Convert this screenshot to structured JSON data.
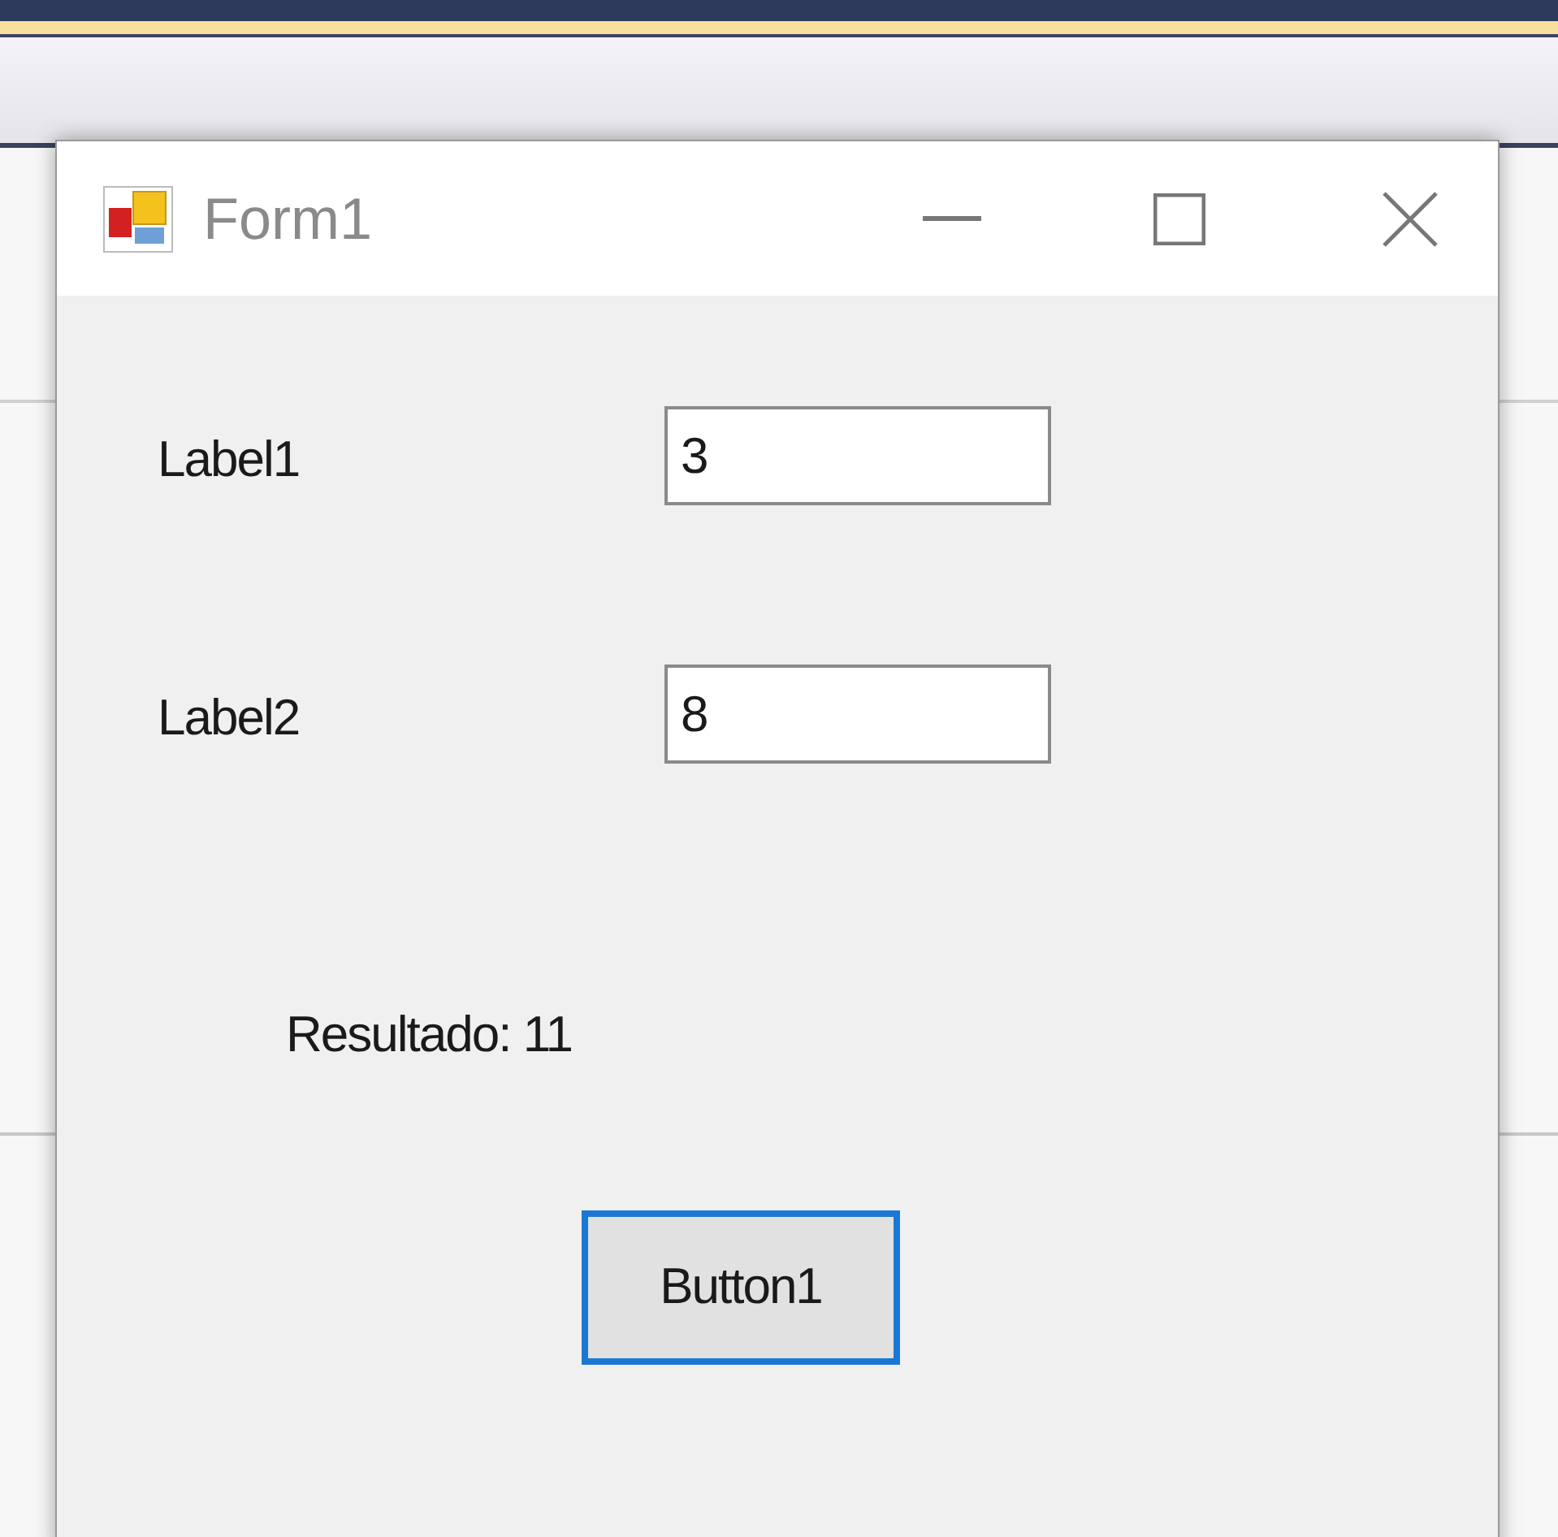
{
  "window": {
    "title": "Form1"
  },
  "fields": [
    {
      "label": "Label1",
      "value": "3"
    },
    {
      "label": "Label2",
      "value": "8"
    }
  ],
  "result": "Resultado: 11",
  "button": {
    "label": "Button1",
    "focused": true
  }
}
